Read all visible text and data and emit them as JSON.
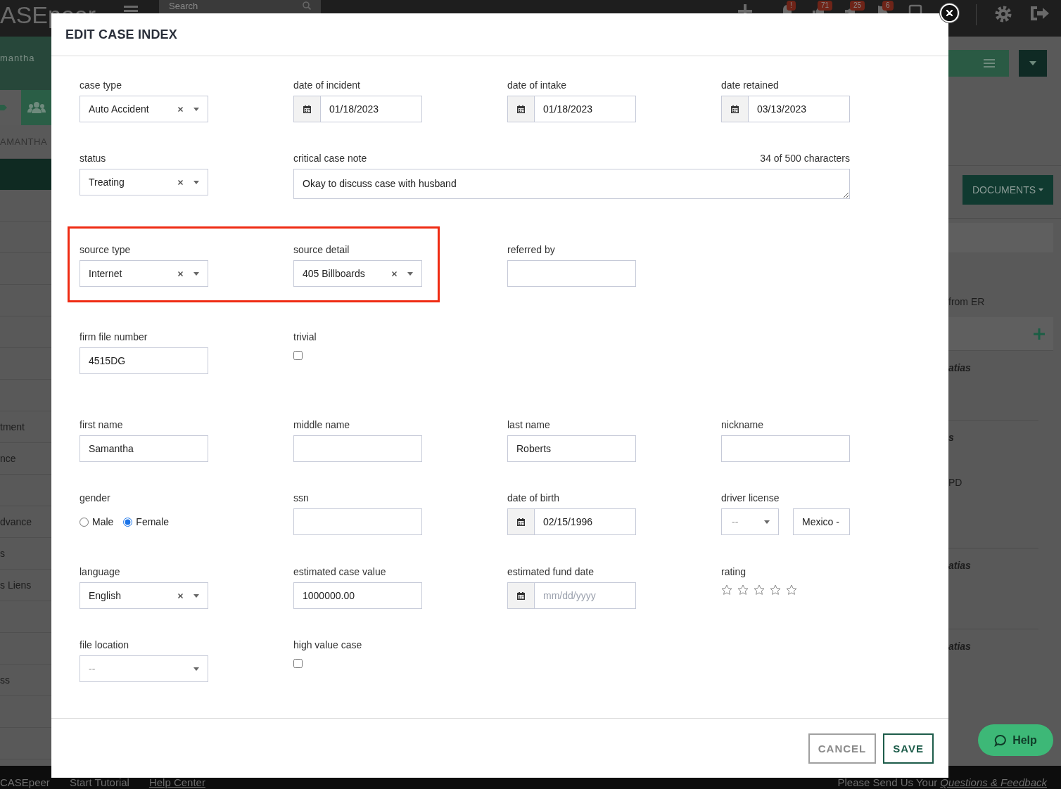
{
  "app": {
    "logo": "ASEpeer",
    "search": {
      "placeholder": "Search"
    },
    "badges": [
      "!",
      "71",
      "25",
      "6"
    ],
    "sidebar": {
      "client_name": "mantha",
      "client_banner": "AMANTHA",
      "items": [
        {
          "label": "tment"
        },
        {
          "label": "nce"
        },
        {
          "label": "dvance"
        },
        {
          "label": "s"
        },
        {
          "label": "s Liens"
        },
        {
          "label": "ss"
        }
      ]
    },
    "panel": {
      "documents_button": "DOCUMENTS",
      "note": "from ER",
      "entries": [
        {
          "lines": [
            {
              "kind": "author",
              "text": "atias"
            }
          ]
        },
        {
          "lines": [
            {
              "kind": "author",
              "text": "s"
            },
            {
              "kind": "note",
              "text": "PD"
            }
          ]
        },
        {
          "lines": [
            {
              "kind": "author",
              "text": "atias"
            }
          ]
        },
        {
          "lines": [
            {
              "kind": "author",
              "text": "atias"
            }
          ]
        }
      ]
    },
    "footer": {
      "brand": "CASEpeer",
      "links": [
        {
          "label": "Start Tutorial",
          "underlined": false
        },
        {
          "label": "Help Center",
          "underlined": true
        }
      ],
      "feedback_prefix": "Please Send Us Your",
      "feedback_link": "Questions & Feedback"
    },
    "help_button": "Help"
  },
  "modal": {
    "title": "EDIT CASE INDEX",
    "rows": [
      {
        "fields": [
          {
            "kind": "select",
            "label": "case type",
            "value": "Auto Accident",
            "clearable": true
          },
          {
            "kind": "date",
            "label": "date of incident",
            "value": "01/18/2023"
          },
          {
            "kind": "date",
            "label": "date of intake",
            "value": "01/18/2023"
          },
          {
            "kind": "date",
            "label": "date retained",
            "value": "03/13/2023"
          }
        ]
      },
      {
        "fields": [
          {
            "kind": "select",
            "label": "status",
            "value": "Treating",
            "clearable": true
          },
          {
            "kind": "textarea",
            "label": "critical case note",
            "counter": "34 of 500 characters",
            "value": "Okay to discuss case with husband"
          }
        ]
      },
      {
        "fields": [
          {
            "kind": "select",
            "label": "source type",
            "value": "Internet",
            "clearable": true,
            "highlighted": true
          },
          {
            "kind": "select",
            "label": "source detail",
            "value": "405 Billboards",
            "clearable": true,
            "highlighted": true
          },
          {
            "kind": "text",
            "label": "referred by",
            "highlighted": false
          }
        ]
      },
      {
        "fields": [
          {
            "kind": "text",
            "label": "firm file number",
            "value": "4515DG"
          },
          {
            "kind": "checkbox",
            "label": "trivial",
            "checked": false
          }
        ]
      },
      {
        "fields": [
          {
            "kind": "text",
            "label": "first name",
            "value": "Samantha"
          },
          {
            "kind": "text",
            "label": "middle name"
          },
          {
            "kind": "text",
            "label": "last name",
            "value": "Roberts"
          },
          {
            "kind": "text",
            "label": "nickname"
          }
        ]
      },
      {
        "fields": [
          {
            "kind": "radio",
            "label": "gender",
            "options": [
              {
                "label": "Male",
                "selected": false
              },
              {
                "label": "Female",
                "selected": true
              }
            ]
          },
          {
            "kind": "text",
            "label": "ssn"
          },
          {
            "kind": "date",
            "label": "date of birth",
            "value": "02/15/1996"
          },
          {
            "kind": "license",
            "label": "driver license",
            "state_placeholder": "--",
            "value": "Mexico -"
          }
        ]
      },
      {
        "fields": [
          {
            "kind": "select",
            "label": "language",
            "value": "English",
            "clearable": true
          },
          {
            "kind": "text",
            "label": "estimated case value",
            "value": "1000000.00"
          },
          {
            "kind": "date",
            "label": "estimated fund date",
            "placeholder": "mm/dd/yyyy"
          },
          {
            "kind": "rating",
            "label": "rating",
            "stars": 0
          }
        ]
      },
      {
        "fields": [
          {
            "kind": "select",
            "label": "file location",
            "placeholder": "--",
            "clearable": false
          },
          {
            "kind": "checkbox",
            "label": "high value case",
            "checked": false
          }
        ]
      }
    ],
    "buttons": [
      {
        "label": "CANCEL",
        "kind": "secondary"
      },
      {
        "label": "SAVE",
        "kind": "primary"
      }
    ]
  }
}
